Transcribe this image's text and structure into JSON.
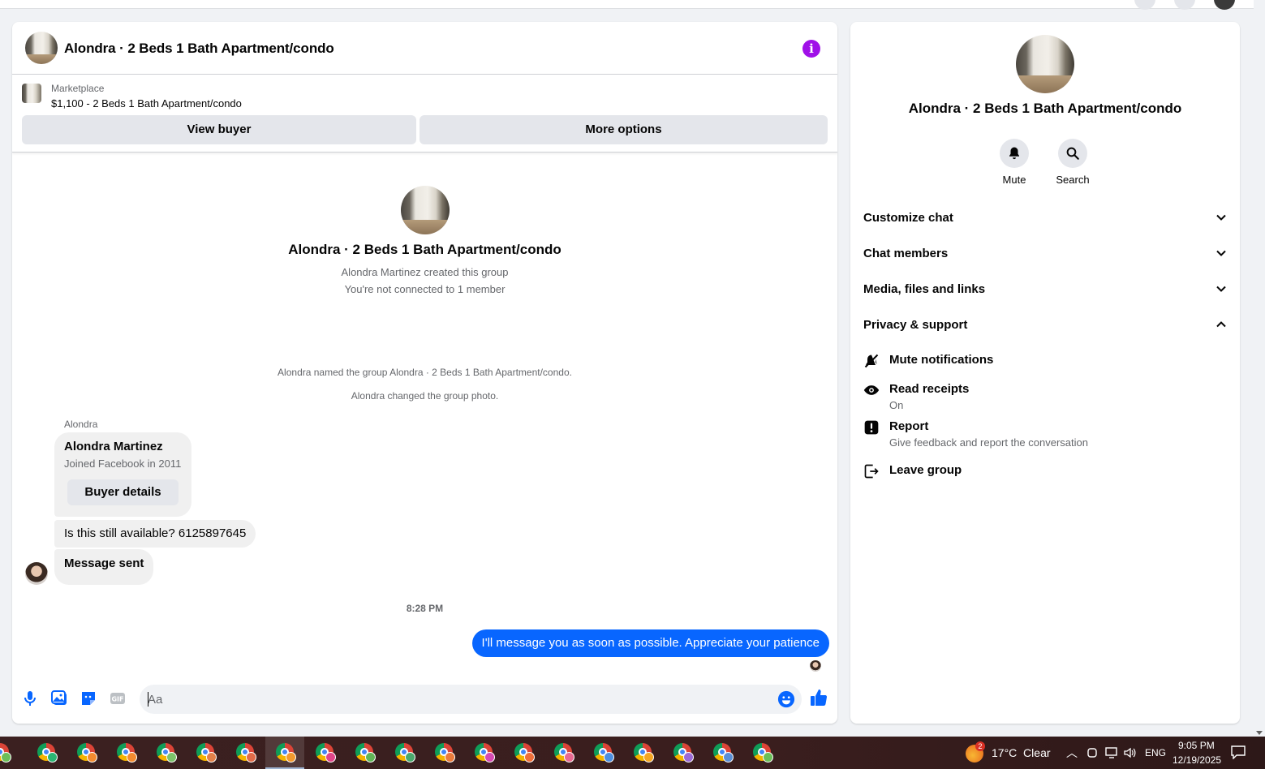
{
  "conversation": {
    "title": "Alondra · 2 Beds 1 Bath Apartment/condo"
  },
  "listing": {
    "source": "Marketplace",
    "price_title": "$1,100 - 2 Beds 1 Bath Apartment/condo",
    "view_buyer_label": "View buyer",
    "more_options_label": "More options"
  },
  "intro": {
    "title": "Alondra · 2 Beds 1 Bath Apartment/condo",
    "created": "Alondra Martinez created this group",
    "connection": "You're not connected to 1 member"
  },
  "system_messages": [
    "Alondra named the group Alondra · 2 Beds 1 Bath Apartment/condo.",
    "Alondra changed the group photo."
  ],
  "messages": {
    "sender": "Alondra",
    "card_name": "Alondra Martinez",
    "card_joined": "Joined Facebook in 2011",
    "card_button": "Buyer details",
    "incoming_1": "Is this still available? 6125897645",
    "incoming_2": "Message sent",
    "timestamp": "8:28 PM",
    "outgoing": "I'll message you as soon as possible. Appreciate your patience"
  },
  "composer": {
    "placeholder": "Aa",
    "icons": [
      "microphone-icon",
      "photo-icon",
      "sticker-icon",
      "gif-icon",
      "emoji-icon",
      "thumbs-up-icon"
    ]
  },
  "info_panel": {
    "title": "Alondra · 2 Beds 1 Bath Apartment/condo",
    "actions": [
      {
        "label": "Mute",
        "icon": "bell-icon"
      },
      {
        "label": "Search",
        "icon": "search-icon"
      }
    ],
    "sections": [
      {
        "label": "Customize chat",
        "expanded": false
      },
      {
        "label": "Chat members",
        "expanded": false
      },
      {
        "label": "Media, files and links",
        "expanded": false
      },
      {
        "label": "Privacy & support",
        "expanded": true
      }
    ],
    "privacy_items": [
      {
        "label": "Mute notifications",
        "sub": "",
        "icon": "bell-slash-icon"
      },
      {
        "label": "Read receipts",
        "sub": "On",
        "icon": "eye-icon"
      },
      {
        "label": "Report",
        "sub": "Give feedback and report the conversation",
        "icon": "alert-icon"
      },
      {
        "label": "Leave group",
        "sub": "",
        "icon": "leave-icon"
      }
    ]
  },
  "taskbar": {
    "weather_badge": "2",
    "weather": "17°C  Clear",
    "language": "ENG",
    "time": "9:05 PM",
    "date": "12/19/2025"
  },
  "colors": {
    "messenger_blue": "#0866ff",
    "info_purple": "#a010e8"
  }
}
